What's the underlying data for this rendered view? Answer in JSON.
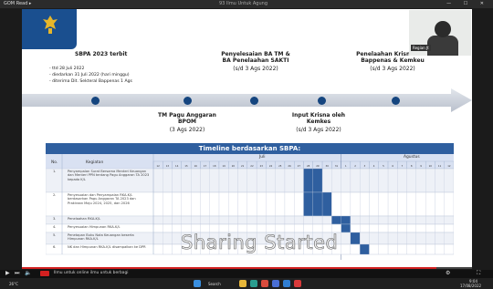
{
  "window": {
    "app_title": "GOM Read ▸",
    "title": "93 Ilmu Untuk Agung",
    "controls": "— ☐ ✕"
  },
  "slide": {
    "events_top": [
      {
        "title": "SBPA 2023 terbit",
        "date": ""
      },
      {
        "title": "Penyelesaian BA TM & BA Penelaahan SAKTI",
        "date": "(s/d 3 Ags 2022)"
      },
      {
        "title": "Penelaahan Krisna oleh Bappenas & Kemkeu",
        "date": "(s/d 3 Ags 2022)"
      }
    ],
    "events_bottom": [
      {
        "title": "TM Pagu Anggaran BPOM",
        "date": "(3 Ags 2022)"
      },
      {
        "title": "Input Krisna oleh Kemkes",
        "date": "(s/d 3 Ags 2022)"
      }
    ],
    "sbpa_notes": [
      "- ttd 28 Juli 2022",
      "- diedarkan 31 Juli 2022 (hari minggu)",
      "- diterima Dit. Sekteral Bappenas 1 Ags"
    ],
    "webcam_tag": "Regian Jt",
    "table": {
      "title": "Timeline berdasarkan SBPA:",
      "col_no": "No.",
      "col_activity": "Kegiatan",
      "month_juli": "Juli",
      "month_agustus": "Agustus",
      "days_juli": [
        "12",
        "13",
        "14",
        "15",
        "16",
        "17",
        "18",
        "19",
        "20",
        "21",
        "22",
        "23",
        "24",
        "25",
        "26",
        "27",
        "28",
        "29",
        "30",
        "31"
      ],
      "days_agustus": [
        "1",
        "2",
        "3",
        "4",
        "5",
        "6",
        "7",
        "8",
        "9",
        "10",
        "11",
        "12"
      ],
      "rows": [
        {
          "no": "1.",
          "text": "Penyampaian Surat Bersama Menteri Keuangan dan Menteri PPN tentang Pagu Anggaran TA 2023 kepada K/L"
        },
        {
          "no": "2.",
          "text": "Penyesuaian dan Penyampaian RKA-K/L berdasarkan Pagu Anggaran TA 2023 dan Prakiraan Maju 2024, 2025, dan 2026"
        },
        {
          "no": "3.",
          "text": "Penelaahan RKA-K/L"
        },
        {
          "no": "4.",
          "text": "Penyesuaian Himpunan RKA-K/L"
        },
        {
          "no": "5.",
          "text": "Penetapan Buku Nota Keuangan beserta Himpunan RKA-K/L"
        },
        {
          "no": "6.",
          "text": "NK dan Himpunan RKA-K/L disampaikan ke DPR"
        }
      ]
    },
    "overlay_text": "Sharing Started"
  },
  "player": {
    "caption": "Ilmu untuk online ilmu untuk berbagi",
    "progress": 0.92
  },
  "taskbar": {
    "weather": "26°C",
    "search": "Search",
    "time": "9:04",
    "date": "17/08/2022"
  },
  "colors": {
    "accent": "#2f5f9f",
    "highlight": "#2f5f9f",
    "navy": "#15457f"
  }
}
